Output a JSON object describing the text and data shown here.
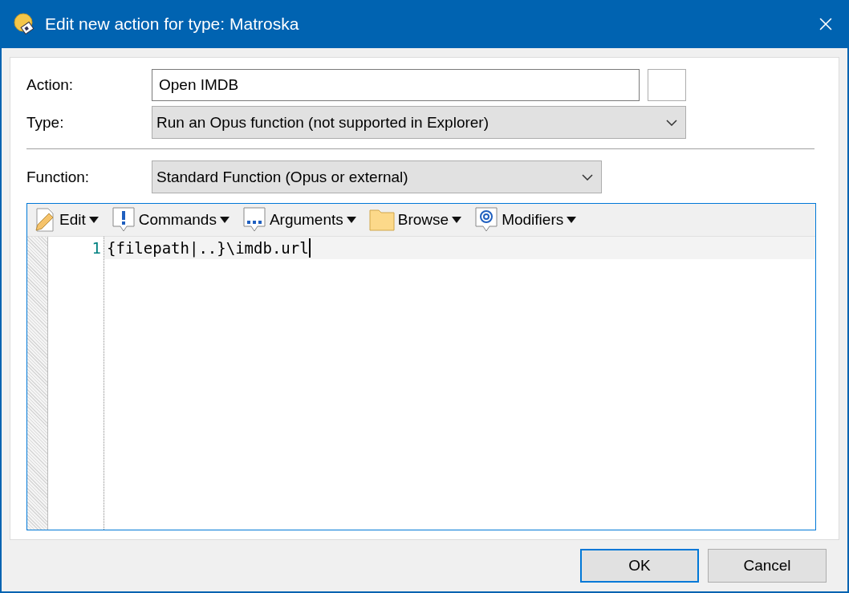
{
  "window": {
    "title": "Edit new action for type: Matroska"
  },
  "fields": [
    {
      "kind": "text",
      "label": "Action:",
      "value": "Open IMDB"
    },
    {
      "kind": "dropdown",
      "label": "Type:",
      "value": "Run an Opus function (not supported in Explorer)"
    }
  ],
  "function": {
    "label": "Function:",
    "value": "Standard Function (Opus or external)"
  },
  "toolbar": [
    {
      "kind": "pencil",
      "label": "Edit"
    },
    {
      "kind": "exclaim",
      "label": "Commands"
    },
    {
      "kind": "dots",
      "label": "Arguments"
    },
    {
      "kind": "folder",
      "label": "Browse"
    },
    {
      "kind": "at",
      "label": "Modifiers"
    }
  ],
  "editor": {
    "lines": [
      {
        "number": "1",
        "text": "{filepath|..}\\imdb.url"
      }
    ]
  },
  "buttons": [
    {
      "label": "OK",
      "selected": true
    },
    {
      "label": "Cancel",
      "selected": false
    }
  ]
}
